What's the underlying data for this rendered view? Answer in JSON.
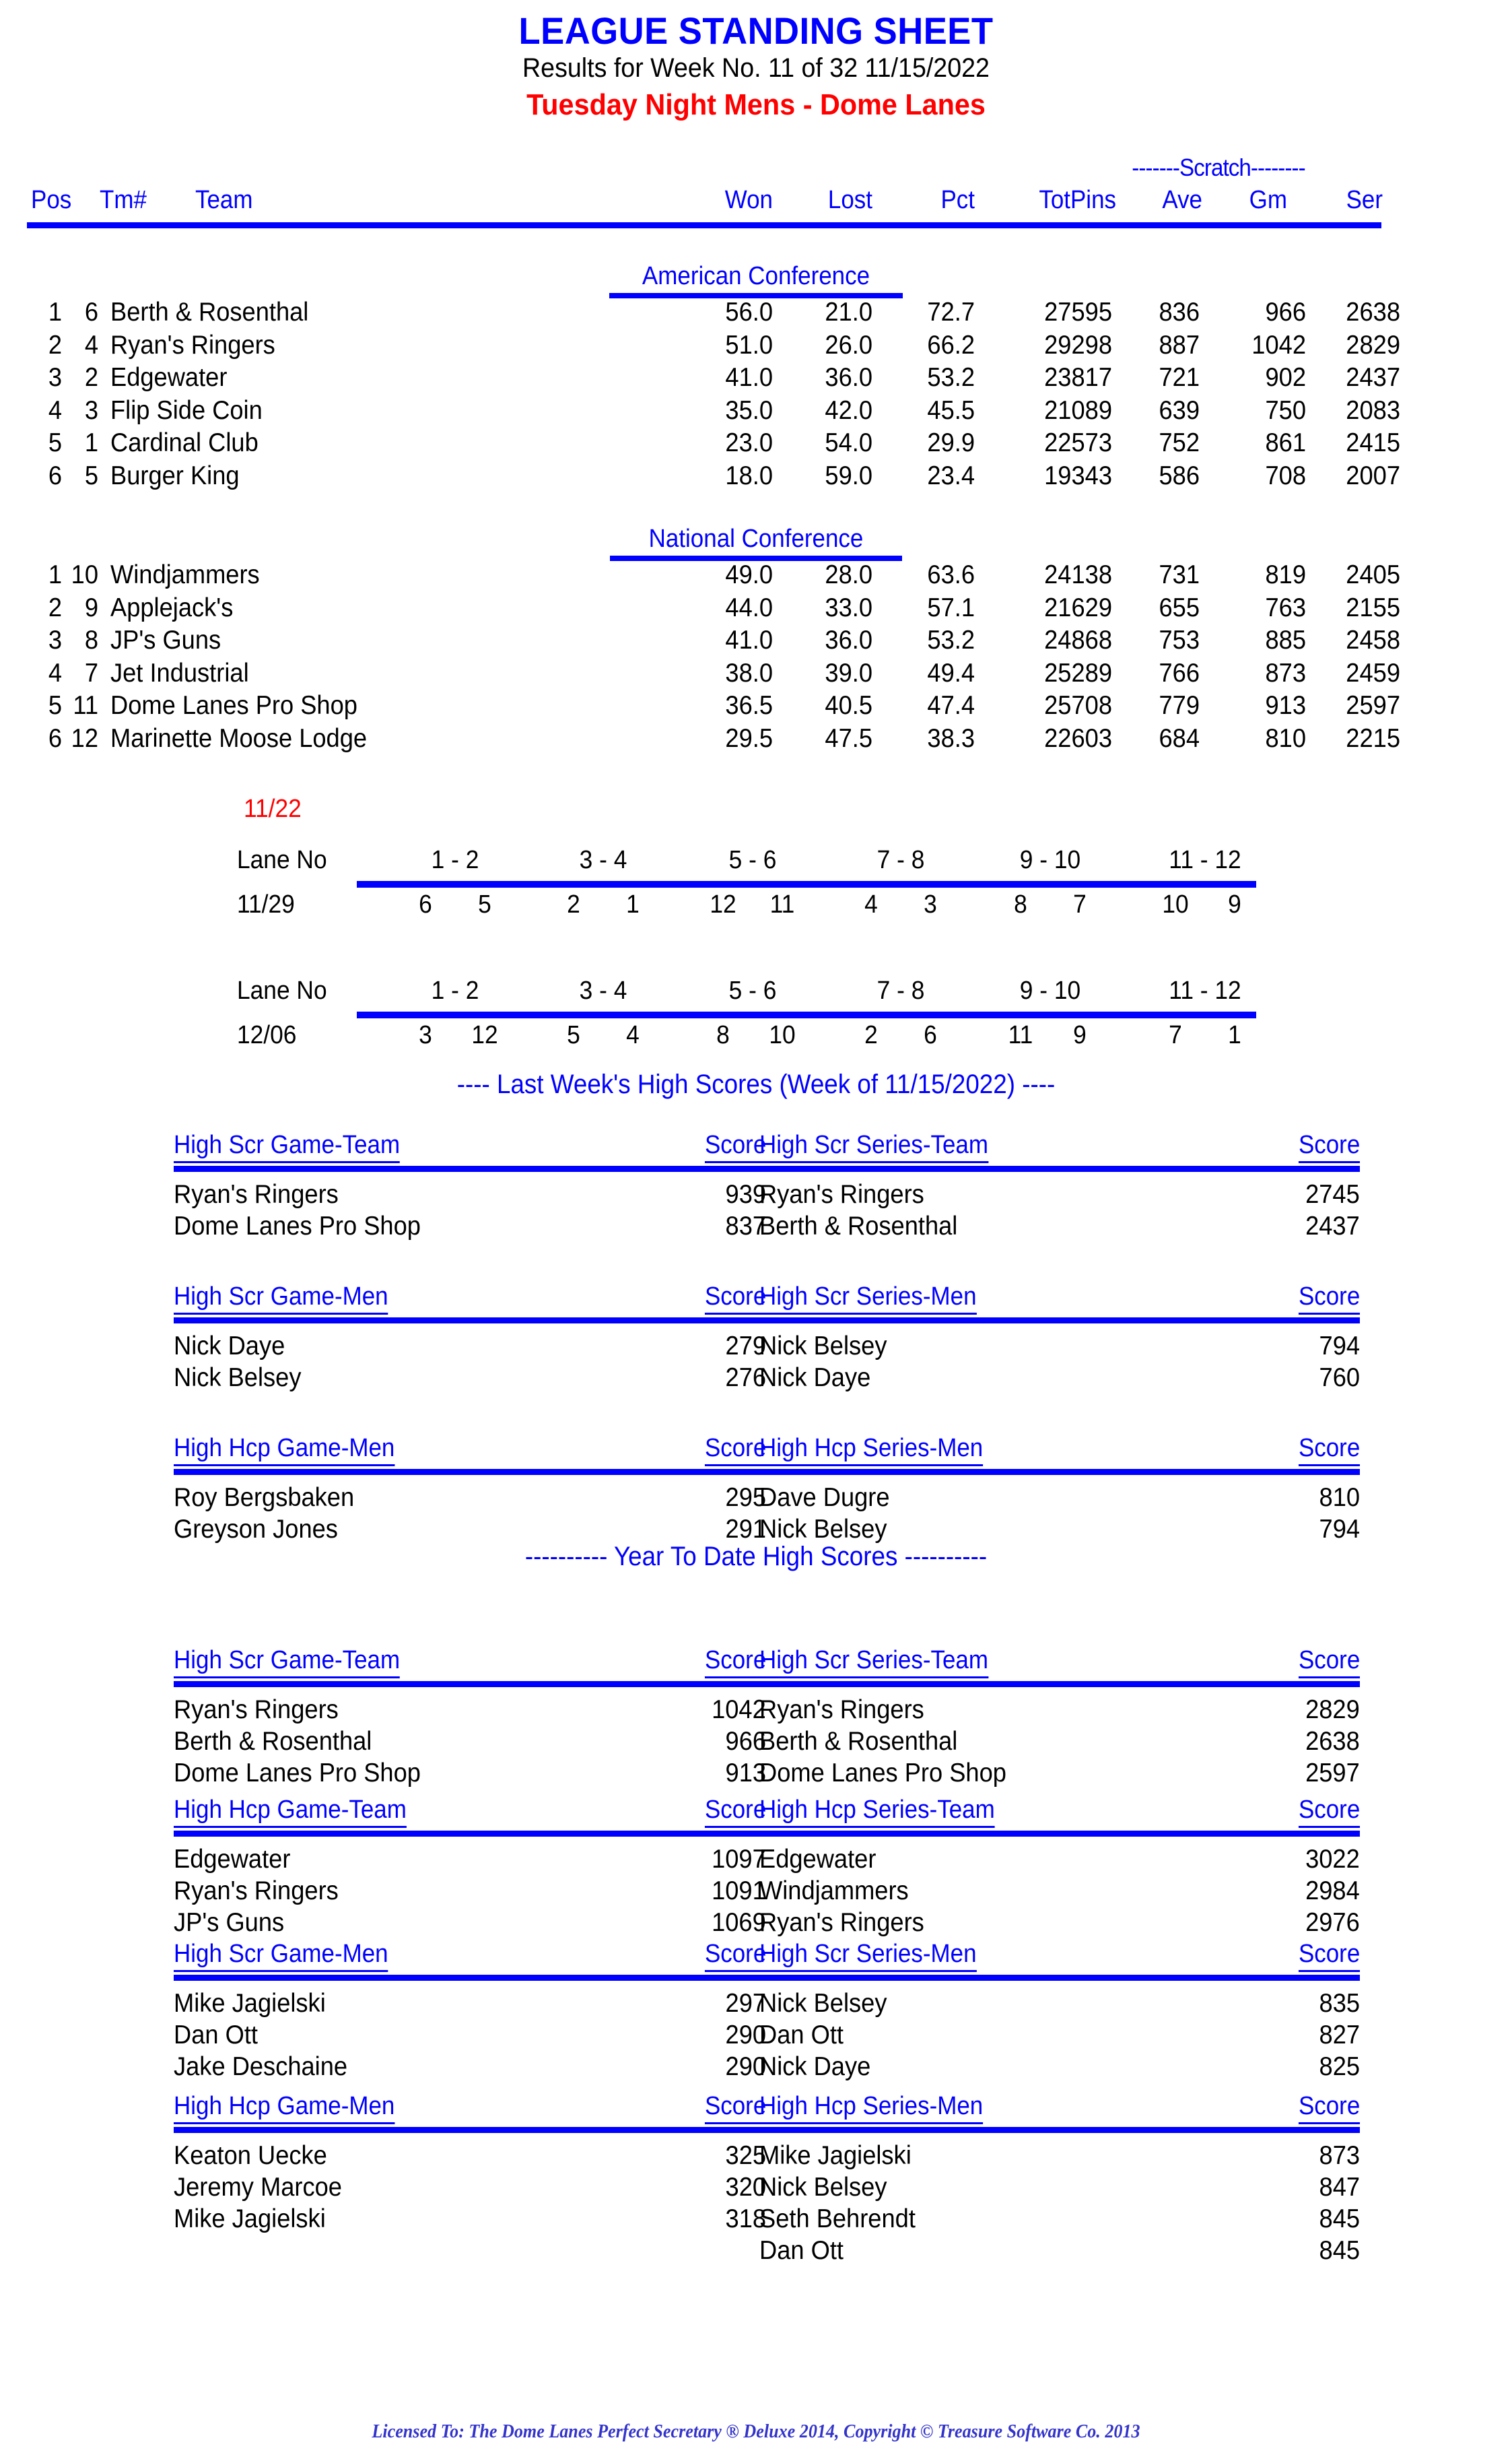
{
  "header": {
    "title": "LEAGUE STANDING SHEET",
    "results_line": "Results for Week No. 11 of 32    11/15/2022",
    "league_line": "Tuesday Night Mens - Dome Lanes",
    "scratch_band": "-------Scratch--------",
    "columns": {
      "pos": "Pos",
      "tm": "Tm#",
      "team": "Team",
      "won": "Won",
      "lost": "Lost",
      "pct": "Pct",
      "totpins": "TotPins",
      "ave": "Ave",
      "gm": "Gm",
      "ser": "Ser"
    }
  },
  "conferences": [
    {
      "name": "American Conference",
      "rows": [
        {
          "pos": "1",
          "tm": "6",
          "team": "Berth & Rosenthal",
          "won": "56.0",
          "lost": "21.0",
          "pct": "72.7",
          "totpins": "27595",
          "ave": "836",
          "gm": "966",
          "ser": "2638"
        },
        {
          "pos": "2",
          "tm": "4",
          "team": "Ryan's Ringers",
          "won": "51.0",
          "lost": "26.0",
          "pct": "66.2",
          "totpins": "29298",
          "ave": "887",
          "gm": "1042",
          "ser": "2829"
        },
        {
          "pos": "3",
          "tm": "2",
          "team": "Edgewater",
          "won": "41.0",
          "lost": "36.0",
          "pct": "53.2",
          "totpins": "23817",
          "ave": "721",
          "gm": "902",
          "ser": "2437"
        },
        {
          "pos": "4",
          "tm": "3",
          "team": "Flip Side Coin",
          "won": "35.0",
          "lost": "42.0",
          "pct": "45.5",
          "totpins": "21089",
          "ave": "639",
          "gm": "750",
          "ser": "2083"
        },
        {
          "pos": "5",
          "tm": "1",
          "team": "Cardinal Club",
          "won": "23.0",
          "lost": "54.0",
          "pct": "29.9",
          "totpins": "22573",
          "ave": "752",
          "gm": "861",
          "ser": "2415"
        },
        {
          "pos": "6",
          "tm": "5",
          "team": "Burger King",
          "won": "18.0",
          "lost": "59.0",
          "pct": "23.4",
          "totpins": "19343",
          "ave": "586",
          "gm": "708",
          "ser": "2007"
        }
      ]
    },
    {
      "name": "National Conference",
      "rows": [
        {
          "pos": "1",
          "tm": "10",
          "team": "Windjammers",
          "won": "49.0",
          "lost": "28.0",
          "pct": "63.6",
          "totpins": "24138",
          "ave": "731",
          "gm": "819",
          "ser": "2405"
        },
        {
          "pos": "2",
          "tm": "9",
          "team": "Applejack's",
          "won": "44.0",
          "lost": "33.0",
          "pct": "57.1",
          "totpins": "21629",
          "ave": "655",
          "gm": "763",
          "ser": "2155"
        },
        {
          "pos": "3",
          "tm": "8",
          "team": "JP's Guns",
          "won": "41.0",
          "lost": "36.0",
          "pct": "53.2",
          "totpins": "24868",
          "ave": "753",
          "gm": "885",
          "ser": "2458"
        },
        {
          "pos": "4",
          "tm": "7",
          "team": "Jet Industrial",
          "won": "38.0",
          "lost": "39.0",
          "pct": "49.4",
          "totpins": "25289",
          "ave": "766",
          "gm": "873",
          "ser": "2459"
        },
        {
          "pos": "5",
          "tm": "11",
          "team": "Dome Lanes Pro Shop",
          "won": "36.5",
          "lost": "40.5",
          "pct": "47.4",
          "totpins": "25708",
          "ave": "779",
          "gm": "913",
          "ser": "2597"
        },
        {
          "pos": "6",
          "tm": "12",
          "team": "Marinette Moose Lodge",
          "won": "29.5",
          "lost": "47.5",
          "pct": "38.3",
          "totpins": "22603",
          "ave": "684",
          "gm": "810",
          "ser": "2215"
        }
      ]
    }
  ],
  "schedule": {
    "next_week_label": "11/22",
    "lane_no_label": "Lane No",
    "lane_pairs": [
      "1 - 2",
      "3 - 4",
      "5 - 6",
      "7 - 8",
      "9 - 10",
      "11 - 12"
    ],
    "blocks": [
      {
        "date": "11/29",
        "matchups": [
          {
            "a": "6",
            "b": "5"
          },
          {
            "a": "2",
            "b": "1"
          },
          {
            "a": "12",
            "b": "11"
          },
          {
            "a": "4",
            "b": "3"
          },
          {
            "a": "8",
            "b": "7"
          },
          {
            "a": "10",
            "b": "9"
          }
        ]
      },
      {
        "date": "12/06",
        "matchups": [
          {
            "a": "3",
            "b": "12"
          },
          {
            "a": "5",
            "b": "4"
          },
          {
            "a": "8",
            "b": "10"
          },
          {
            "a": "2",
            "b": "6"
          },
          {
            "a": "11",
            "b": "9"
          },
          {
            "a": "7",
            "b": "1"
          }
        ]
      }
    ]
  },
  "last_week": {
    "banner": "----  Last Week's High Scores   (Week of 11/15/2022)  ----",
    "score_header": "Score",
    "tables": [
      {
        "title": "High Scr Game-Team",
        "rows": [
          {
            "name": "Ryan's Ringers",
            "score": "939"
          },
          {
            "name": "Dome Lanes Pro Shop",
            "score": "837"
          }
        ]
      },
      {
        "title": "High Scr Series-Team",
        "rows": [
          {
            "name": "Ryan's Ringers",
            "score": "2745"
          },
          {
            "name": "Berth & Rosenthal",
            "score": "2437"
          }
        ]
      },
      {
        "title": "High Scr Game-Men",
        "rows": [
          {
            "name": "Nick Daye",
            "score": "279"
          },
          {
            "name": "Nick Belsey",
            "score": "276"
          }
        ]
      },
      {
        "title": "High Scr Series-Men",
        "rows": [
          {
            "name": "Nick Belsey",
            "score": "794"
          },
          {
            "name": "Nick Daye",
            "score": "760"
          }
        ]
      },
      {
        "title": "High Hcp Game-Men",
        "rows": [
          {
            "name": "Roy Bergsbaken",
            "score": "295"
          },
          {
            "name": "Greyson Jones",
            "score": "291"
          }
        ]
      },
      {
        "title": "High Hcp Series-Men",
        "rows": [
          {
            "name": "Dave Dugre",
            "score": "810"
          },
          {
            "name": "Nick Belsey",
            "score": "794"
          }
        ]
      }
    ]
  },
  "year_to_date": {
    "banner": "---------- Year To Date High Scores ----------",
    "score_header": "Score",
    "tables": [
      {
        "title": "High Scr Game-Team",
        "rows": [
          {
            "name": "Ryan's Ringers",
            "score": "1042"
          },
          {
            "name": "Berth & Rosenthal",
            "score": "966"
          },
          {
            "name": "Dome Lanes Pro Shop",
            "score": "913"
          }
        ]
      },
      {
        "title": "High Scr Series-Team",
        "rows": [
          {
            "name": "Ryan's Ringers",
            "score": "2829"
          },
          {
            "name": "Berth & Rosenthal",
            "score": "2638"
          },
          {
            "name": "Dome Lanes Pro Shop",
            "score": "2597"
          }
        ]
      },
      {
        "title": "High Hcp Game-Team",
        "rows": [
          {
            "name": "Edgewater",
            "score": "1097"
          },
          {
            "name": "Ryan's Ringers",
            "score": "1091"
          },
          {
            "name": "JP's Guns",
            "score": "1069"
          }
        ]
      },
      {
        "title": "High Hcp Series-Team",
        "rows": [
          {
            "name": "Edgewater",
            "score": "3022"
          },
          {
            "name": "Windjammers",
            "score": "2984"
          },
          {
            "name": "Ryan's Ringers",
            "score": "2976"
          }
        ]
      },
      {
        "title": "High Scr Game-Men",
        "rows": [
          {
            "name": "Mike Jagielski",
            "score": "297"
          },
          {
            "name": "Dan Ott",
            "score": "290"
          },
          {
            "name": "Jake Deschaine",
            "score": "290"
          }
        ]
      },
      {
        "title": "High Scr Series-Men",
        "rows": [
          {
            "name": "Nick Belsey",
            "score": "835"
          },
          {
            "name": "Dan Ott",
            "score": "827"
          },
          {
            "name": "Nick Daye",
            "score": "825"
          }
        ]
      },
      {
        "title": "High Hcp Game-Men",
        "rows": [
          {
            "name": "Keaton Uecke",
            "score": "325"
          },
          {
            "name": "Jeremy Marcoe",
            "score": "320"
          },
          {
            "name": "Mike Jagielski",
            "score": "318"
          }
        ]
      },
      {
        "title": "High Hcp Series-Men",
        "rows": [
          {
            "name": "Mike Jagielski",
            "score": "873"
          },
          {
            "name": "Nick Belsey",
            "score": "847"
          },
          {
            "name": "Seth Behrendt",
            "score": "845"
          },
          {
            "name": "Dan Ott",
            "score": "845"
          }
        ]
      }
    ]
  },
  "footer": {
    "text": "Licensed To: The Dome Lanes    Perfect Secretary ® Deluxe  2014, Copyright © Treasure Software Co. 2013"
  },
  "colors": {
    "accent_blue": "#0000ff",
    "accent_red": "#ff0000",
    "footer_blue": "#3333cc"
  }
}
